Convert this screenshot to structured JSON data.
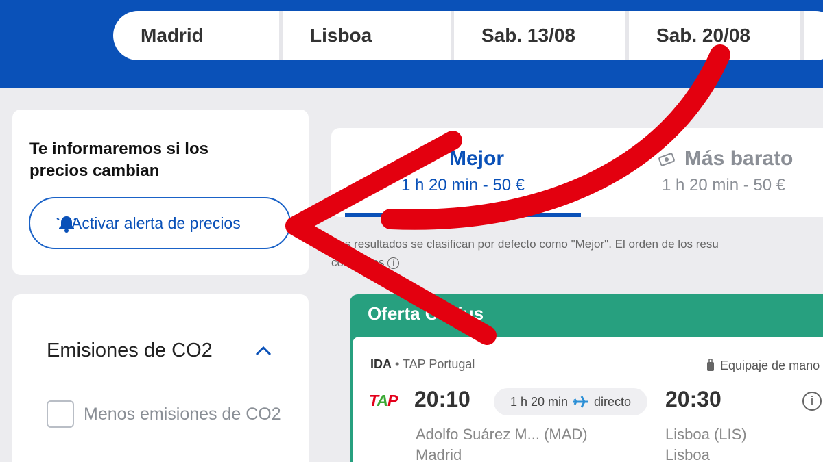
{
  "search": {
    "origin": "Madrid",
    "destination": "Lisboa",
    "depart_date": "Sab. 13/08",
    "return_date": "Sab. 20/08"
  },
  "alert": {
    "title": "Te informaremos si los precios cambian",
    "button_label": "Activar alerta de precios",
    "icon": "bell-icon"
  },
  "filters": {
    "section_title": "Emisiones de CO2",
    "option_label": "Menos emisiones de CO2"
  },
  "sort_tabs": [
    {
      "label": "Mejor",
      "summary": "1 h 20 min - 50 €",
      "icon": "plane-icon"
    },
    {
      "label": "Más barato",
      "summary": "1 h 20 min - 50 €",
      "icon": "money-icon"
    }
  ],
  "sort_note": {
    "line1": "tros resultados se clasifican por defecto como \"Mejor\". El orden de los resu",
    "line2": "comi    tes"
  },
  "offer": {
    "title": "Oferta C    ius",
    "flight": {
      "direction": "IDA",
      "airline": "• TAP Portugal",
      "airline_logo": "TAP",
      "luggage": "Equipaje de mano",
      "depart_time": "20:10",
      "duration": "1 h 20 min",
      "stops": "directo",
      "arrive_time": "20:30",
      "depart_airport": "Adolfo Suárez M... (MAD)",
      "depart_city": "Madrid",
      "arrive_airport": "Lisboa (LIS)",
      "arrive_city": "Lisboa"
    }
  },
  "colors": {
    "brand_blue": "#0a51b8",
    "offer_green": "#27a07f",
    "annotation_red": "#e3000f"
  }
}
